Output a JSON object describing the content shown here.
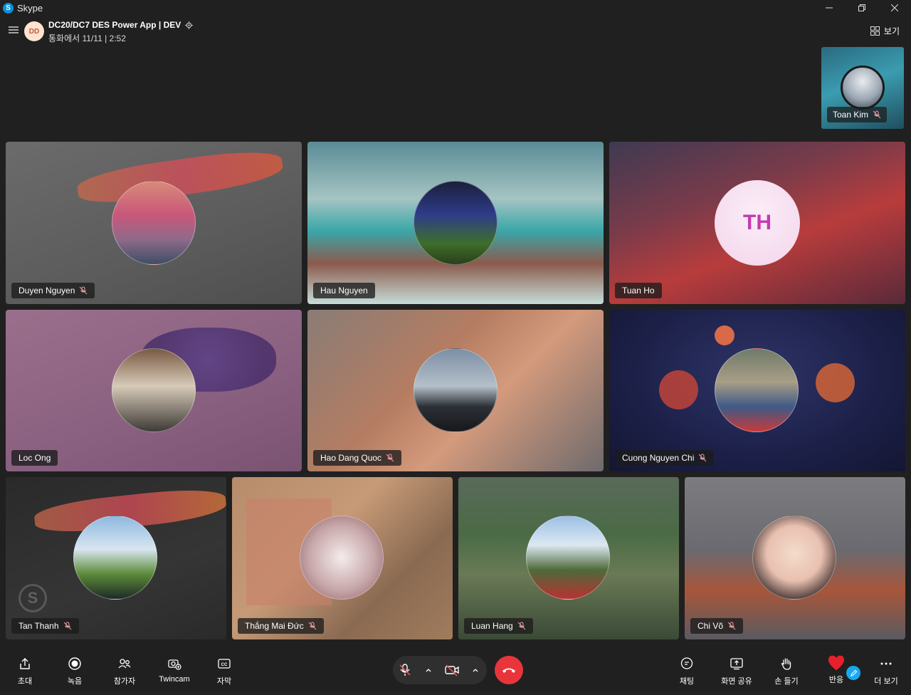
{
  "window": {
    "title": "Skype",
    "logo_letter": "S"
  },
  "header": {
    "avatar_initials": "DD",
    "call_title": "DC20/DC7 DES Power App | DEV",
    "call_status": "통화에서 11/11 | 2:52",
    "view_label": "보기"
  },
  "self_preview": {
    "name": "Toan Kim",
    "muted": true
  },
  "participants": [
    {
      "name": "Duyen Nguyen",
      "muted": true
    },
    {
      "name": "Hau Nguyen",
      "muted": false
    },
    {
      "name": "Tuan Ho",
      "muted": false,
      "initials": "TH"
    },
    {
      "name": "Loc Ong",
      "muted": false
    },
    {
      "name": "Hao Dang Quoc",
      "muted": true
    },
    {
      "name": "Cuong Nguyen Chi",
      "muted": true
    },
    {
      "name": "Tan Thanh",
      "muted": true
    },
    {
      "name": "Thắng Mai Đức",
      "muted": true
    },
    {
      "name": "Luan Hang",
      "muted": true
    },
    {
      "name": "Chi Võ",
      "muted": true
    }
  ],
  "toolbar": {
    "invite": "초대",
    "record": "녹음",
    "participants": "참가자",
    "twincam": "Twincam",
    "captions": "자막",
    "chat": "채팅",
    "share_screen": "화면 공유",
    "raise_hand": "손 들기",
    "react": "반응",
    "more": "더 보기"
  },
  "colors": {
    "background": "#202020",
    "end_call": "#e8353c",
    "accent": "#1aa8f0",
    "heart": "#e8202c",
    "muted_icon": "#f0a0a8"
  }
}
